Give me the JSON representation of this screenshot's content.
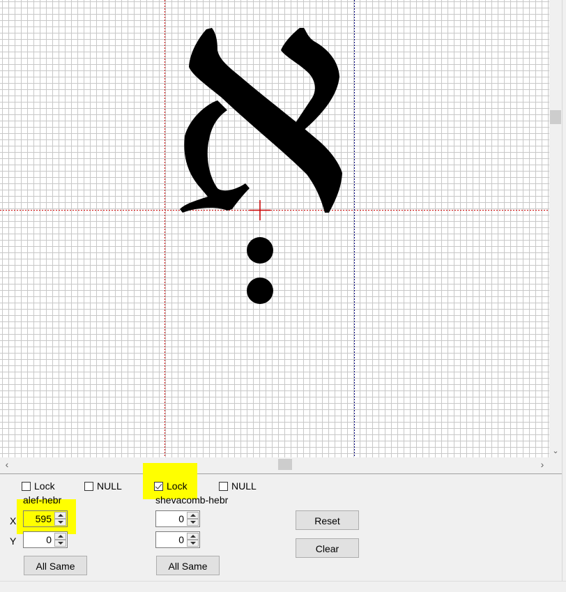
{
  "glyphs": {
    "base_char": "א"
  },
  "columns": [
    {
      "lock_label": "Lock",
      "lock_checked": false,
      "null_label": "NULL",
      "null_checked": false,
      "glyph_name": "alef-hebr",
      "x_value": "595",
      "y_value": "0",
      "all_same_label": "All Same"
    },
    {
      "lock_label": "Lock",
      "lock_checked": true,
      "null_label": "NULL",
      "null_checked": false,
      "glyph_name": "shevacomb-hebr",
      "x_value": "0",
      "y_value": "0",
      "all_same_label": "All Same"
    }
  ],
  "axis_labels": {
    "x": "X",
    "y": "Y"
  },
  "buttons": {
    "reset": "Reset",
    "clear": "Clear"
  },
  "scroll": {
    "left_arrow": "‹",
    "right_arrow": "›",
    "down_arrow": "⌄"
  },
  "colors": {
    "highlight": "#ffff00",
    "guide_red": "#cc0000",
    "guide_blue": "#000080",
    "grid": "#c8c8c8"
  }
}
